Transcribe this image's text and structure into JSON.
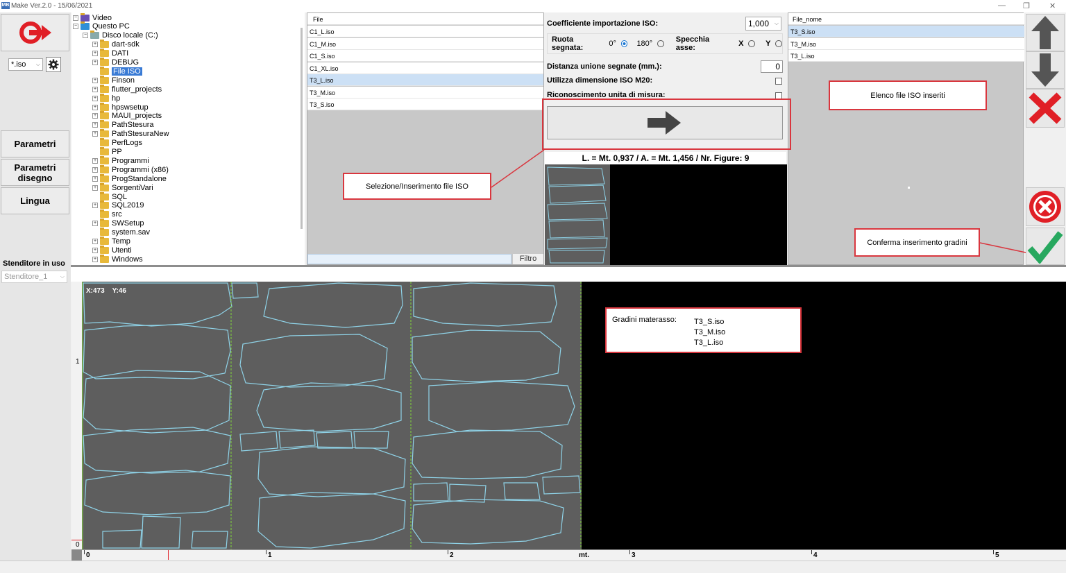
{
  "window": {
    "title": "Make  Ver.2.0 - 15/06/2021",
    "logo": "MB"
  },
  "left_menu": {
    "exit_icon": "power-exit-icon",
    "filter_value": "*.iso",
    "settings_icon": "gear-icon",
    "buttons": [
      "Parametri",
      "Parametri\ndisegno",
      "Lingua"
    ],
    "stenditore_label": "Stenditore in uso",
    "stenditore_value": "Stenditore_1"
  },
  "tree": {
    "items": [
      {
        "label": "Video",
        "level": 0,
        "icon": "video"
      },
      {
        "label": "Questo PC",
        "level": 0,
        "icon": "pc"
      },
      {
        "label": "Disco locale (C:)",
        "level": 1,
        "icon": "drive"
      },
      {
        "label": "dart-sdk",
        "level": 2
      },
      {
        "label": "DATI",
        "level": 2
      },
      {
        "label": "DEBUG",
        "level": 2
      },
      {
        "label": "File ISO",
        "level": 2,
        "selected": true
      },
      {
        "label": "Finson",
        "level": 2
      },
      {
        "label": "flutter_projects",
        "level": 2
      },
      {
        "label": "hp",
        "level": 2
      },
      {
        "label": "hpswsetup",
        "level": 2
      },
      {
        "label": "MAUI_projects",
        "level": 2
      },
      {
        "label": "PathStesura",
        "level": 2
      },
      {
        "label": "PathStesuraNew",
        "level": 2
      },
      {
        "label": "PerfLogs",
        "level": 2
      },
      {
        "label": "PP",
        "level": 2
      },
      {
        "label": "Programmi",
        "level": 2
      },
      {
        "label": "Programmi (x86)",
        "level": 2
      },
      {
        "label": "ProgStandalone",
        "level": 2
      },
      {
        "label": "SorgentiVari",
        "level": 2
      },
      {
        "label": "SQL",
        "level": 2
      },
      {
        "label": "SQL2019",
        "level": 2
      },
      {
        "label": "src",
        "level": 2
      },
      {
        "label": "SWSetup",
        "level": 2
      },
      {
        "label": "system.sav",
        "level": 2
      },
      {
        "label": "Temp",
        "level": 2
      },
      {
        "label": "Utenti",
        "level": 2
      },
      {
        "label": "Windows",
        "level": 2
      }
    ]
  },
  "file_list": {
    "header": "File",
    "rows": [
      "C1_L.iso",
      "C1_M.iso",
      "C1_S.iso",
      "C1_XL.iso",
      "T3_L.iso",
      "T3_M.iso",
      "T3_S.iso"
    ],
    "selected": "T3_L.iso",
    "filter_label": "Filtro"
  },
  "params": {
    "coeff_label": "Coefficiente importazione ISO:",
    "coeff_value": "1,000",
    "rotate_label": "Ruota segnata:",
    "rot_0": "0°",
    "rot_180": "180°",
    "mirror_label": "Specchia asse:",
    "axis_x": "X",
    "axis_y": "Y",
    "distance_label": "Distanza unione segnate (mm.):",
    "distance_value": "0",
    "m20_label": "Utilizza dimensione ISO M20:",
    "unit_label": "Riconoscimento unita di misura:",
    "summary": "L. = Mt. 0,937 / A. = Mt. 1,456 / Nr. Figure: 9"
  },
  "iso_list": {
    "header": "File_nome",
    "rows": [
      "T3_S.iso",
      "T3_M.iso",
      "T3_L.iso"
    ],
    "selected": "T3_S.iso"
  },
  "annotations": {
    "selection": "Selezione/Inserimento file ISO",
    "elenco": "Elenco file ISO inseriti",
    "conferma": "Conferma inserimento gradini",
    "gradini_label": "Gradini  materasso:",
    "gradini_files": [
      "T3_S.iso",
      "T3_M.iso",
      "T3_L.iso"
    ]
  },
  "canvas": {
    "coords": "X:473    Y:46",
    "ruler_x_labels": [
      "0",
      "1",
      "2",
      "3",
      "4",
      "5"
    ],
    "ruler_unit": "mt.",
    "ruler_y_labels": [
      "1",
      "0"
    ],
    "colors": {
      "piece": "#8fd3e8",
      "bg": "#5e5e5e",
      "divider": "#7cc242"
    }
  },
  "right_toolbar": {
    "icons": [
      "arrow-up-icon",
      "arrow-down-icon",
      "delete-x-icon",
      "cancel-circle-icon",
      "confirm-check-icon"
    ]
  }
}
